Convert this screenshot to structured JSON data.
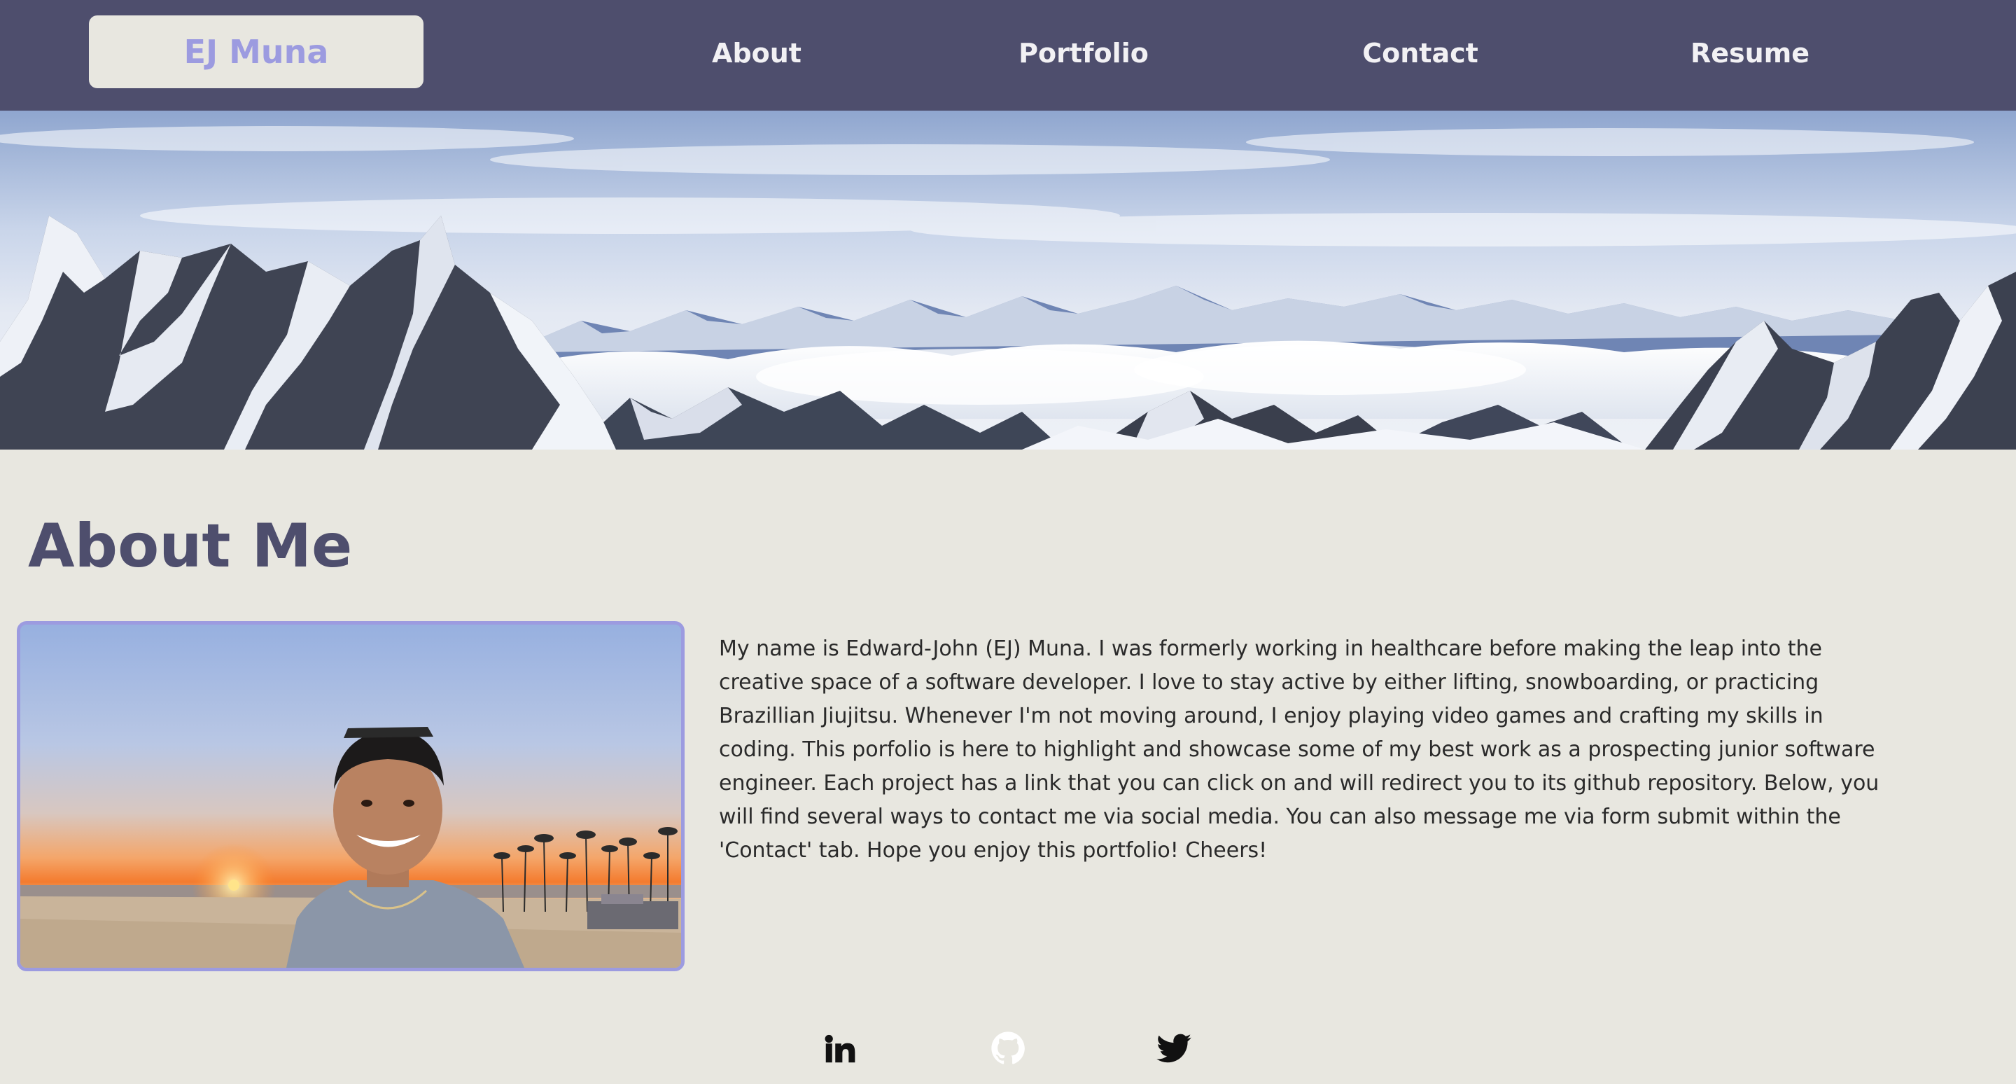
{
  "nav": {
    "brand": "EJ Muna",
    "links": [
      "About",
      "Portfolio",
      "Contact",
      "Resume"
    ]
  },
  "about": {
    "title": "About Me",
    "bio": "My name is Edward-John (EJ) Muna. I was formerly working in healthcare before making the leap into the creative space of a software developer. I love to stay active by either lifting, snowboarding, or practicing Brazillian Jiujitsu. Whenever I'm not moving around, I enjoy playing video games and crafting my skills in coding. This porfolio is here to highlight and showcase some of my best work as a prospecting junior software engineer. Each project has a link that you can click on and will redirect you to its github repository. Below, you will find several ways to contact me via social media. You can also message me via form submit within the 'Contact' tab. Hope you enjoy this portfolio! Cheers!"
  },
  "social": {
    "icons": [
      "linkedin-icon",
      "github-icon",
      "twitter-icon"
    ]
  },
  "colors": {
    "nav_bg": "#4e4e6d",
    "page_bg": "#e8e7e0",
    "accent": "#9c9be0",
    "title": "#4e4e6d"
  }
}
